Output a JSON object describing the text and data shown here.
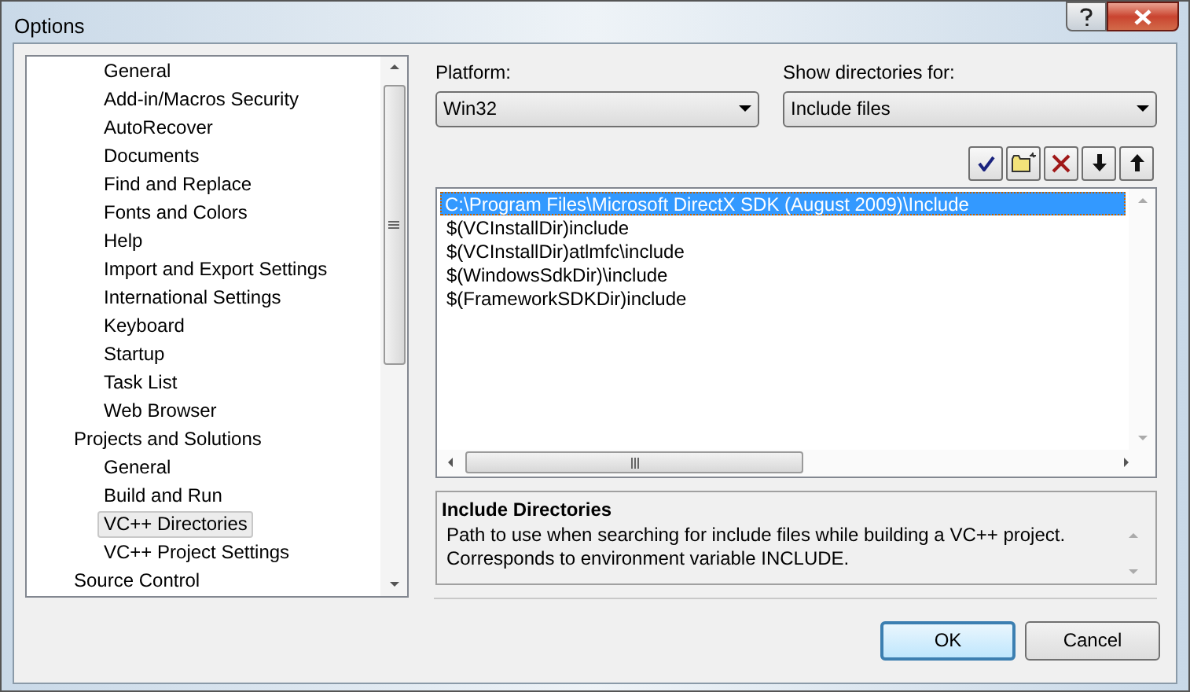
{
  "window": {
    "title": "Options"
  },
  "tree": [
    {
      "children": [
        {
          "label": "General",
          "selected": false
        },
        {
          "label": "Add-in/Macros Security",
          "selected": false
        },
        {
          "label": "AutoRecover",
          "selected": false
        },
        {
          "label": "Documents",
          "selected": false
        },
        {
          "label": "Find and Replace",
          "selected": false
        },
        {
          "label": "Fonts and Colors",
          "selected": false
        },
        {
          "label": "Help",
          "selected": false
        },
        {
          "label": "Import and Export Settings",
          "selected": false
        },
        {
          "label": "International Settings",
          "selected": false
        },
        {
          "label": "Keyboard",
          "selected": false
        },
        {
          "label": "Startup",
          "selected": false
        },
        {
          "label": "Task List",
          "selected": false
        },
        {
          "label": "Web Browser",
          "selected": false
        }
      ]
    },
    {
      "label": "Projects and Solutions",
      "selected": false,
      "children": [
        {
          "label": "General",
          "selected": false
        },
        {
          "label": "Build and Run",
          "selected": false
        },
        {
          "label": "VC++ Directories",
          "selected": true
        },
        {
          "label": "VC++ Project Settings",
          "selected": false
        }
      ]
    },
    {
      "label": "Source Control",
      "selected": false
    }
  ],
  "platform": {
    "label": "Platform:",
    "value": "Win32"
  },
  "show_directories": {
    "label": "Show directories for:",
    "value": "Include files"
  },
  "directories": [
    {
      "path": "C:\\Program Files\\Microsoft DirectX SDK (August 2009)\\Include",
      "selected": true
    },
    {
      "path": "$(VCInstallDir)include",
      "selected": false
    },
    {
      "path": "$(VCInstallDir)atlmfc\\include",
      "selected": false
    },
    {
      "path": "$(WindowsSdkDir)\\include",
      "selected": false
    },
    {
      "path": "$(FrameworkSDKDir)include",
      "selected": false
    }
  ],
  "description": {
    "title": "Include Directories",
    "text": "Path to use when searching for include files while building a VC++ project.\nCorresponds to environment variable INCLUDE."
  },
  "buttons": [
    {
      "label": "OK",
      "kind": "default"
    },
    {
      "label": "Cancel",
      "kind": "normal"
    }
  ]
}
